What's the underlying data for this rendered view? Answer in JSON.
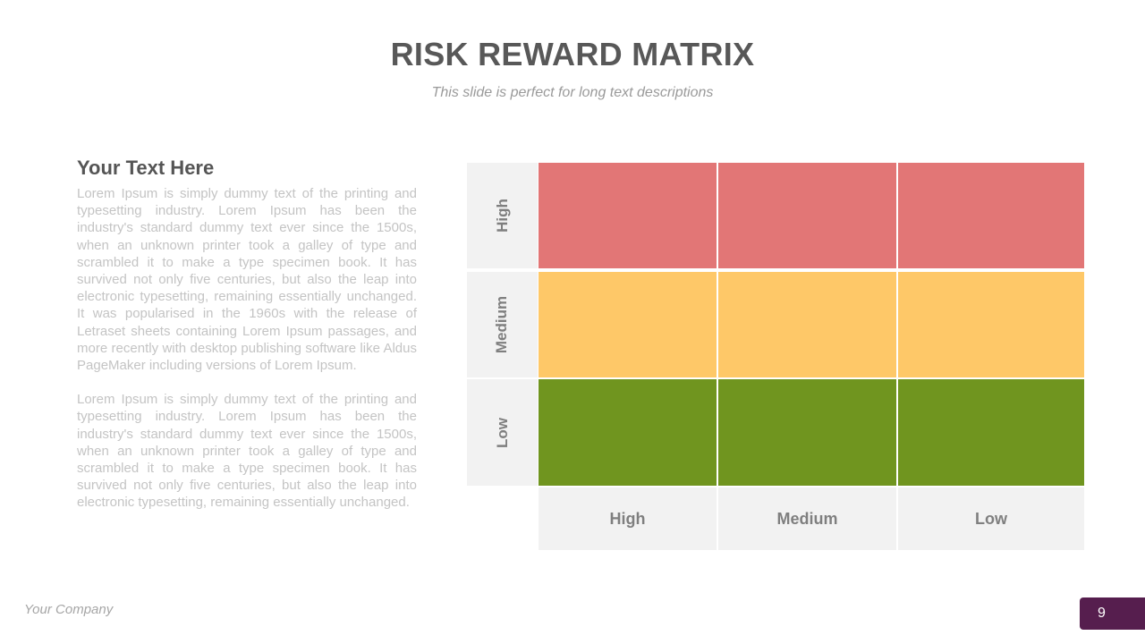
{
  "slide": {
    "title": "RISK REWARD MATRIX",
    "subtitle": "This slide is perfect for long text descriptions"
  },
  "text_block": {
    "heading": "Your Text Here",
    "paragraphs": [
      "Lorem Ipsum is simply dummy text of the printing and typesetting industry. Lorem Ipsum has been the industry's standard dummy text ever since the 1500s, when an unknown printer took a galley of type and scrambled it to make a type specimen book. It has survived not only five centuries, but also the leap into electronic typesetting, remaining essentially unchanged. It was popularised in the 1960s with the release of Letraset sheets containing Lorem Ipsum passages, and more recently with desktop publishing software like Aldus PageMaker including versions of Lorem Ipsum.",
      "Lorem Ipsum is simply dummy text of the printing and typesetting industry. Lorem Ipsum has been the industry's standard dummy text ever since the 1500s, when an unknown printer took a galley of type and scrambled it to make a type specimen book. It has survived not only five centuries, but also the leap into electronic typesetting, remaining essentially unchanged."
    ]
  },
  "matrix": {
    "row_labels": [
      "High",
      "Medium",
      "Low"
    ],
    "col_labels": [
      "High",
      "Medium",
      "Low"
    ],
    "row_colors": {
      "high": "#e27676",
      "medium": "#fec868",
      "low": "#70951f"
    },
    "label_bg": "#f2f2f2",
    "label_color": "#7f7f7f"
  },
  "footer": {
    "company": "Your Company",
    "page_number": "9",
    "badge_color": "#561e4e"
  }
}
